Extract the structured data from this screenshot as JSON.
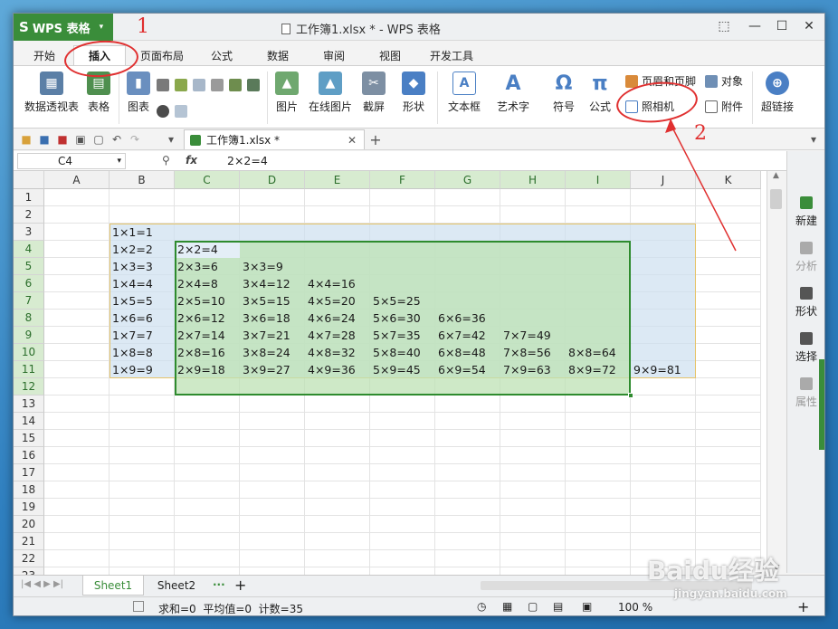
{
  "app": {
    "button_label": "WPS 表格",
    "logo_glyph": "S"
  },
  "title": {
    "text": "工作簿1.xlsx * - WPS 表格"
  },
  "menu_tabs": [
    "开始",
    "插入",
    "页面布局",
    "公式",
    "数据",
    "审阅",
    "视图",
    "开发工具"
  ],
  "active_tab": "插入",
  "ribbon": {
    "large": [
      "数据透视表",
      "表格",
      "图表",
      "图片",
      "在线图片",
      "截屏",
      "形状",
      "文本框",
      "艺术字",
      "符号",
      "公式",
      "超链接"
    ],
    "small": {
      "header_footer": "页眉和页脚",
      "object": "对象",
      "camera": "照相机",
      "attachment": "附件"
    }
  },
  "doc_tab": {
    "label": "工作簿1.xlsx *"
  },
  "formula_bar": {
    "name_box": "C4",
    "fx": "fx",
    "formula": "2×2=4"
  },
  "columns": [
    "A",
    "B",
    "C",
    "D",
    "E",
    "F",
    "G",
    "H",
    "I",
    "J",
    "K"
  ],
  "rows": [
    "1",
    "2",
    "3",
    "4",
    "5",
    "6",
    "7",
    "8",
    "9",
    "10",
    "11",
    "12",
    "13",
    "14",
    "15",
    "16",
    "17",
    "18",
    "19",
    "20",
    "21",
    "22",
    "23"
  ],
  "cells": {
    "B3": "1×1=1",
    "B4": "1×2=2",
    "C4": "2×2=4",
    "B5": "1×3=3",
    "C5": "2×3=6",
    "D5": "3×3=9",
    "B6": "1×4=4",
    "C6": "2×4=8",
    "D6": "3×4=12",
    "E6": "4×4=16",
    "B7": "1×5=5",
    "C7": "2×5=10",
    "D7": "3×5=15",
    "E7": "4×5=20",
    "F7": "5×5=25",
    "B8": "1×6=6",
    "C8": "2×6=12",
    "D8": "3×6=18",
    "E8": "4×6=24",
    "F8": "5×6=30",
    "G8": "6×6=36",
    "B9": "1×7=7",
    "C9": "2×7=14",
    "D9": "3×7=21",
    "E9": "4×7=28",
    "F9": "5×7=35",
    "G9": "6×7=42",
    "H9": "7×7=49",
    "B10": "1×8=8",
    "C10": "2×8=16",
    "D10": "3×8=24",
    "E10": "4×8=32",
    "F10": "5×8=40",
    "G10": "6×8=48",
    "H10": "7×8=56",
    "I10": "8×8=64",
    "B11": "1×9=9",
    "C11": "2×9=18",
    "D11": "3×9=27",
    "E11": "4×9=36",
    "F11": "5×9=45",
    "G11": "6×9=54",
    "H11": "7×9=63",
    "I11": "8×9=72",
    "J11": "9×9=81"
  },
  "right_panel": [
    "新建",
    "分析",
    "形状",
    "选择",
    "属性"
  ],
  "sheets": [
    "Sheet1",
    "Sheet2"
  ],
  "active_sheet": "Sheet1",
  "status": {
    "text": "求和=0  平均值=0  计数=35",
    "zoom": "100 %"
  },
  "annotations": {
    "num1": "1",
    "num2": "2"
  },
  "watermark": {
    "brand": "Baidu经验",
    "url": "jingyan.baidu.com"
  },
  "colors": {
    "accent_green": "#3a8d3a",
    "selection_green": "#2e8b2e",
    "annotation_red": "#e03030"
  }
}
